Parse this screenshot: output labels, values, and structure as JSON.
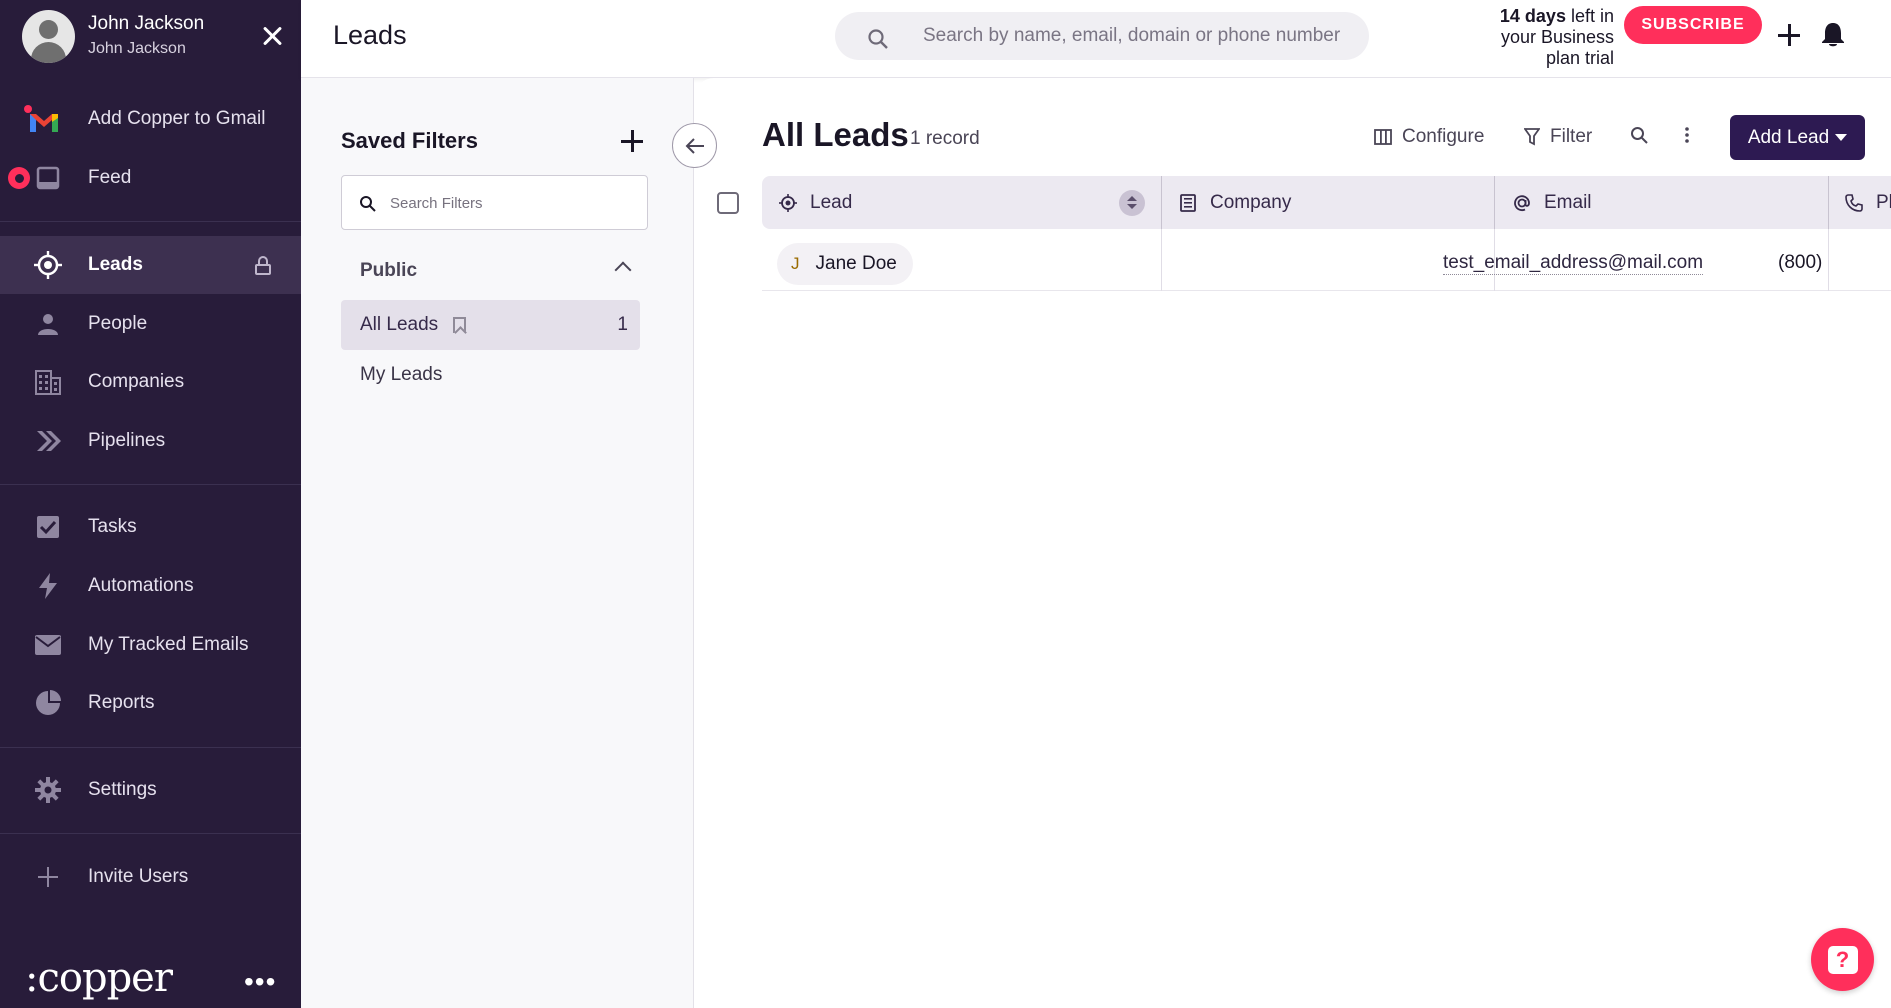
{
  "user": {
    "name": "John Jackson",
    "subtitle": "John Jackson"
  },
  "sidebar": {
    "items": [
      {
        "label": "Add Copper to Gmail",
        "icon": "gmail-icon"
      },
      {
        "label": "Feed",
        "icon": "feed-icon"
      },
      {
        "label": "Leads",
        "icon": "target-icon",
        "active": true
      },
      {
        "label": "People",
        "icon": "person-icon"
      },
      {
        "label": "Companies",
        "icon": "building-icon"
      },
      {
        "label": "Pipelines",
        "icon": "chevrons-right-icon"
      },
      {
        "label": "Tasks",
        "icon": "checkbox-icon"
      },
      {
        "label": "Automations",
        "icon": "lightning-icon"
      },
      {
        "label": "My Tracked Emails",
        "icon": "envelope-icon"
      },
      {
        "label": "Reports",
        "icon": "pie-chart-icon"
      },
      {
        "label": "Settings",
        "icon": "gear-icon"
      },
      {
        "label": "Invite Users",
        "icon": "plus-icon"
      }
    ],
    "logo": ":copper",
    "more": "•••"
  },
  "header": {
    "title": "Leads",
    "search_placeholder": "Search by name, email, domain or phone number",
    "trial_bold": "14 days",
    "trial_rest": " left in your Business plan trial",
    "subscribe_label": "SUBSCRIBE"
  },
  "filters": {
    "title": "Saved Filters",
    "search_placeholder": "Search Filters",
    "group_label": "Public",
    "items": [
      {
        "label": "All Leads",
        "count": "1",
        "active": true
      },
      {
        "label": "My Leads",
        "count": ""
      }
    ]
  },
  "main": {
    "title": "All Leads",
    "record_count": "1 record",
    "toolbar": {
      "configure": "Configure",
      "filter": "Filter",
      "add_lead": "Add Lead"
    },
    "columns": [
      "Lead",
      "Company",
      "Email",
      "Pl"
    ],
    "rows": [
      {
        "initial": "J",
        "lead": "Jane Doe",
        "company": "",
        "email": "test_email_address@mail.com",
        "phone": "(800)"
      }
    ]
  },
  "colors": {
    "sidebar_bg": "#281c3a",
    "accent": "#ff2f5b",
    "primary_button": "#2d1a52"
  }
}
